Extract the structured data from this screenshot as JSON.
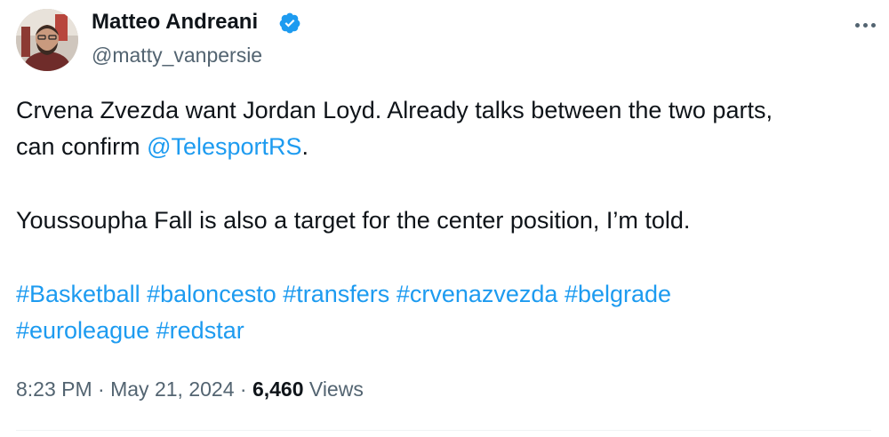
{
  "author": {
    "name": "Matteo Andreani",
    "handle": "@matty_vanpersie",
    "verified_color": "#1d9bf0"
  },
  "menu": {
    "icon": "more-horizontal-icon"
  },
  "tweet": {
    "line1": "Crvena Zvezda want Jordan Loyd. Already talks between the two parts,",
    "line2_prefix": "can confirm ",
    "mention": "@TelesportRS",
    "line2_suffix": ".",
    "line3": "Youssoupha Fall is also a target for the center position, I’m told.",
    "hashtags_line1": [
      "#Basketball",
      "#baloncesto",
      "#transfers",
      "#crvenazvezda",
      "#belgrade"
    ],
    "hashtags_line2": [
      "#euroleague",
      "#redstar"
    ]
  },
  "meta": {
    "time": "8:23 PM",
    "separator": "·",
    "date": "May 21, 2024",
    "views_count": "6,460",
    "views_label": "Views"
  },
  "colors": {
    "text": "#0f1419",
    "secondary": "#536471",
    "link": "#1d9bf0"
  }
}
